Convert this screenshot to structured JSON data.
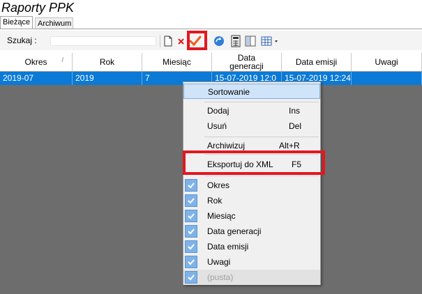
{
  "window": {
    "title": "Raporty PPK"
  },
  "tabs": [
    {
      "label": "Bieżące",
      "active": true
    },
    {
      "label": "Archiwum",
      "active": false
    }
  ],
  "toolbar": {
    "search_label": "Szukaj  :",
    "search_value": "",
    "buttons": [
      "new-document-icon",
      "delete-icon",
      "approve-check-icon",
      "refresh-icon",
      "calculator-icon",
      "columns-icon",
      "grid-options-icon"
    ]
  },
  "grid": {
    "columns": [
      "Okres",
      "Rok",
      "Miesiąc",
      "Data\ngeneracji",
      "Data emisji",
      "Uwagi"
    ],
    "sort_indicator": "/",
    "rows": [
      {
        "okres": "2019-07",
        "rok": "2019",
        "miesiac": "7",
        "data_generacji": "15-07-2019 12:0",
        "data_emisji": "15-07-2019 12:24",
        "uwagi": ""
      }
    ]
  },
  "context_menu": {
    "items": [
      {
        "label": "Sortowanie",
        "shortcut": ""
      },
      {
        "label": "Dodaj",
        "shortcut": "Ins"
      },
      {
        "label": "Usuń",
        "shortcut": "Del"
      },
      {
        "label": "Archiwizuj",
        "shortcut": "Alt+R"
      },
      {
        "label": "Eksportuj do XML",
        "shortcut": "F5"
      }
    ],
    "column_toggles": [
      {
        "label": "Okres",
        "checked": true
      },
      {
        "label": "Rok",
        "checked": true
      },
      {
        "label": "Miesiąc",
        "checked": true
      },
      {
        "label": "Data generacji",
        "checked": true
      },
      {
        "label": "Data emisji",
        "checked": true
      },
      {
        "label": "Uwagi",
        "checked": true
      },
      {
        "label": "(pusta)",
        "checked": true,
        "disabled": true
      }
    ]
  },
  "colors": {
    "highlight_red": "#e3171f",
    "selection_blue": "#0a7ad6",
    "grid_background": "#6d6d6d"
  }
}
